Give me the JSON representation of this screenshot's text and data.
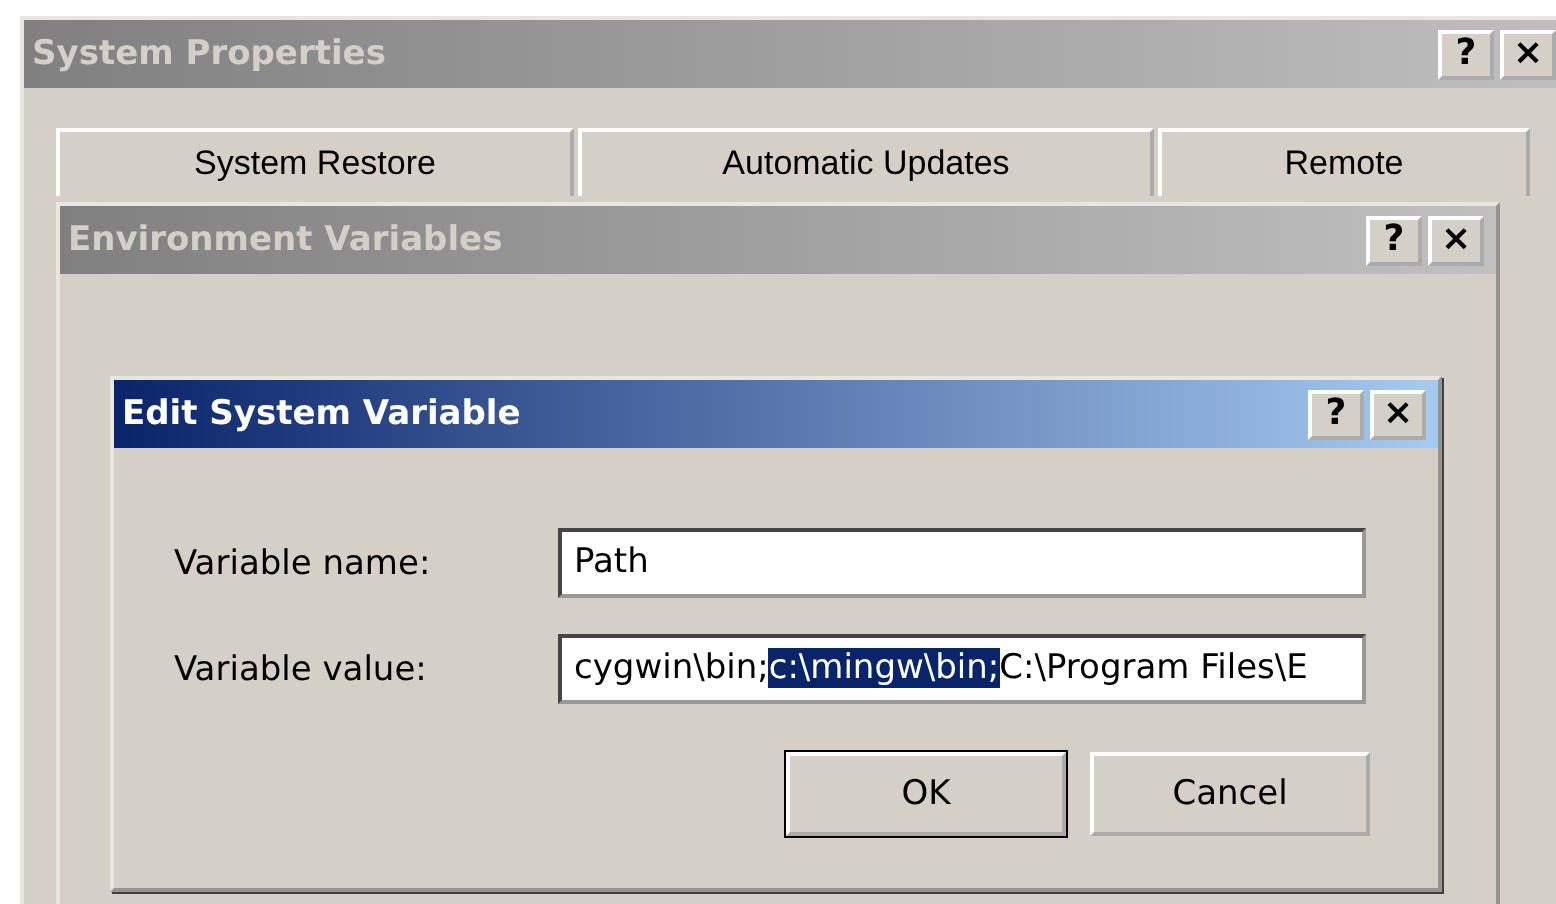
{
  "windows": [
    {
      "title": "System Properties",
      "active": false,
      "help": "?",
      "close": "×",
      "tabs": [
        "System Restore",
        "Automatic Updates",
        "Remote"
      ]
    },
    {
      "title": "Environment Variables",
      "active": false,
      "help": "?",
      "close": "×"
    },
    {
      "title": "Edit System Variable",
      "active": true,
      "help": "?",
      "close": "×",
      "fields": [
        {
          "label": "Variable name:",
          "value": "Path"
        },
        {
          "label": "Variable value:",
          "value_before": "cygwin\\bin;",
          "value_selected": "c:\\mingw\\bin;",
          "value_after": "C:\\Program Files\\E"
        }
      ],
      "buttons": [
        {
          "label": "OK",
          "default": true
        },
        {
          "label": "Cancel",
          "default": false
        }
      ]
    }
  ]
}
